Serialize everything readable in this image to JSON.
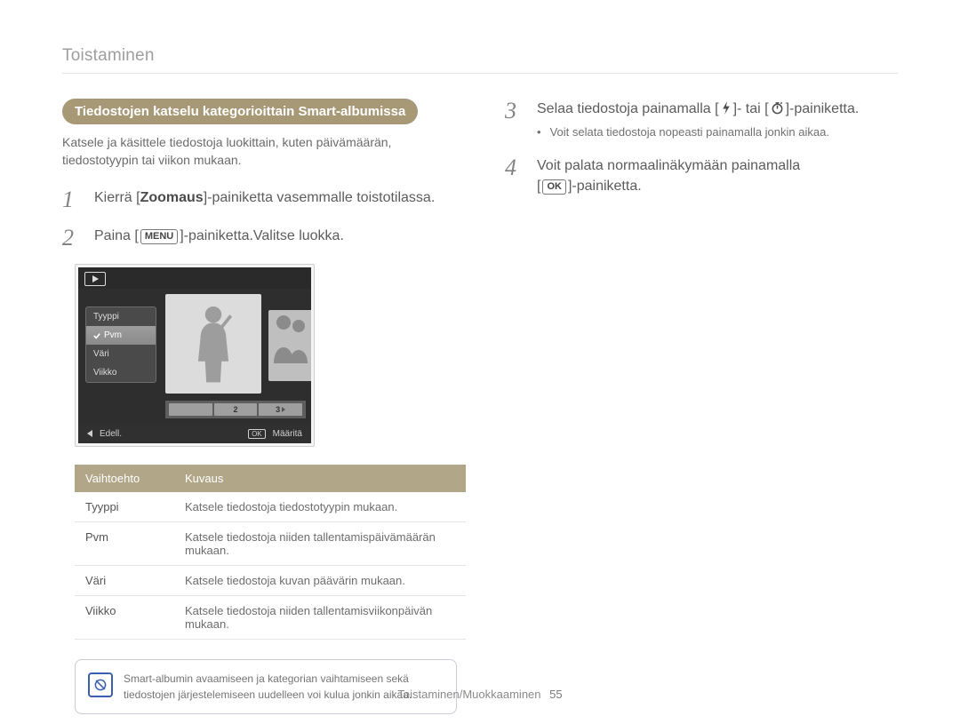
{
  "header": {
    "section": "Toistaminen"
  },
  "left": {
    "subhead": "Tiedostojen katselu kategorioittain Smart-albumissa",
    "intro": "Katsele ja käsittele tiedostoja luokittain, kuten päivämäärän, tiedostotyypin tai viikon mukaan.",
    "step1": {
      "num": "1",
      "pre": "Kierrä [",
      "bold": "Zoomaus",
      "post": "]-painiketta vasemmalle toistotilassa."
    },
    "step2": {
      "num": "2",
      "pre": "Paina [",
      "post": "]-painiketta.Valitse luokka."
    },
    "lcd": {
      "menu": [
        "Tyyppi",
        "Pvm",
        "Väri",
        "Viikko"
      ],
      "menu_active_index": 1,
      "strip": [
        "",
        "2",
        "3"
      ],
      "footer_back": "Edell.",
      "footer_set": "Määritä",
      "footer_ok": "OK"
    },
    "table": {
      "head_option": "Vaihtoehto",
      "head_desc": "Kuvaus",
      "rows": [
        {
          "opt": "Tyyppi",
          "desc": "Katsele tiedostoja tiedostotyypin mukaan."
        },
        {
          "opt": "Pvm",
          "desc": "Katsele tiedostoja niiden tallentamispäivämäärän mukaan."
        },
        {
          "opt": "Väri",
          "desc": "Katsele tiedostoja kuvan päävärin mukaan."
        },
        {
          "opt": "Viikko",
          "desc": "Katsele tiedostoja niiden tallentamisviikonpäivän mukaan."
        }
      ]
    },
    "note": "Smart-albumin avaamiseen ja kategorian vaihtamiseen sekä tiedostojen järjestelemiseen uudelleen voi kulua jonkin aikaa."
  },
  "right": {
    "step3": {
      "num": "3",
      "pre": "Selaa tiedostoja painamalla [",
      "mid": "]- tai [",
      "post": "]-painiketta."
    },
    "step3_bullet": "Voit selata tiedostoja nopeasti painamalla jonkin aikaa.",
    "step4": {
      "num": "4",
      "line1": "Voit palata normaalinäkymään painamalla",
      "line2_pre": "[",
      "line2_post": "]-painiketta."
    }
  },
  "footer": {
    "path": "Toistaminen/Muokkaaminen",
    "page": "55"
  },
  "labels": {
    "menu": "MENU",
    "ok": "OK"
  }
}
